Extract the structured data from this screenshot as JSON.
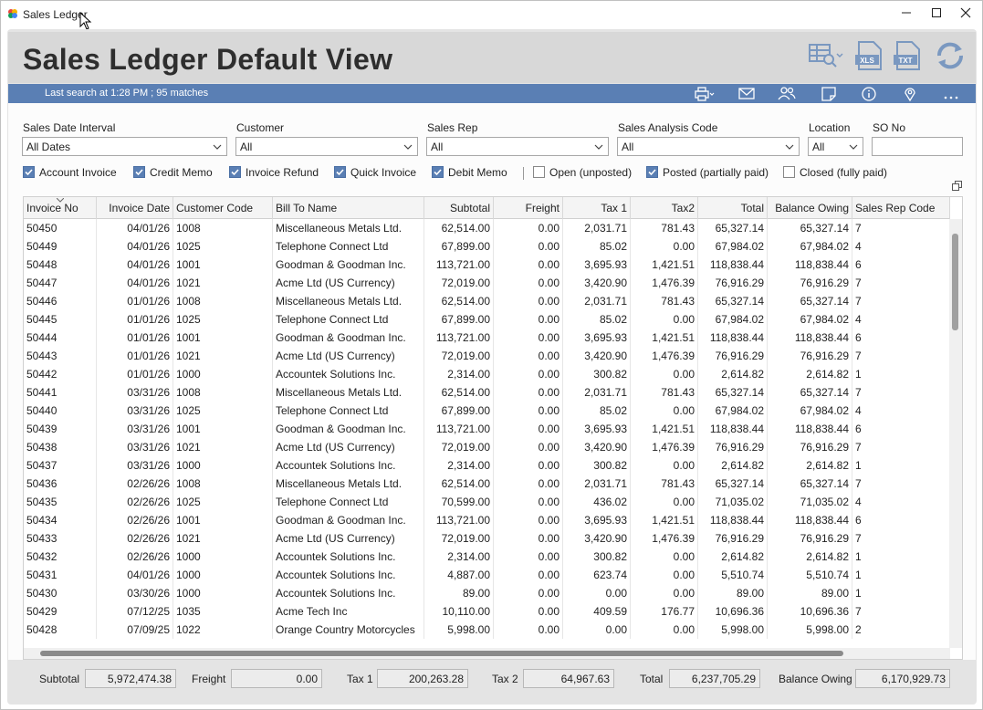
{
  "window": {
    "title": "Sales Ledger"
  },
  "header": {
    "title": "Sales Ledger Default View"
  },
  "statusbar": {
    "text": "Last search at 1:28 PM ; 95 matches"
  },
  "filters": {
    "date_label": "Sales Date Interval",
    "date_value": "All Dates",
    "customer_label": "Customer",
    "customer_value": "All",
    "rep_label": "Sales Rep",
    "rep_value": "All",
    "analysis_label": "Sales Analysis Code",
    "analysis_value": "All",
    "location_label": "Location",
    "location_value": "All",
    "so_label": "SO No",
    "so_value": ""
  },
  "checkboxes": [
    {
      "label": "Account Invoice",
      "checked": true
    },
    {
      "label": "Credit Memo",
      "checked": true
    },
    {
      "label": "Invoice Refund",
      "checked": true
    },
    {
      "label": "Quick Invoice",
      "checked": true
    },
    {
      "label": "Debit Memo",
      "checked": true
    },
    {
      "label": "Open (unposted)",
      "checked": false
    },
    {
      "label": "Posted (partially paid)",
      "checked": true
    },
    {
      "label": "Closed (fully paid)",
      "checked": false
    }
  ],
  "grid": {
    "columns": [
      "Invoice No",
      "Invoice Date",
      "Customer Code",
      "Bill To Name",
      "Subtotal",
      "Freight",
      "Tax 1",
      "Tax2",
      "Total",
      "Balance Owing",
      "Sales Rep Code"
    ],
    "rows": [
      [
        "50450",
        "04/01/26",
        "1008",
        "Miscellaneous Metals Ltd.",
        "62,514.00",
        "0.00",
        "2,031.71",
        "781.43",
        "65,327.14",
        "65,327.14",
        "7"
      ],
      [
        "50449",
        "04/01/26",
        "1025",
        "Telephone Connect Ltd",
        "67,899.00",
        "0.00",
        "85.02",
        "0.00",
        "67,984.02",
        "67,984.02",
        "4"
      ],
      [
        "50448",
        "04/01/26",
        "1001",
        "Goodman & Goodman Inc.",
        "113,721.00",
        "0.00",
        "3,695.93",
        "1,421.51",
        "118,838.44",
        "118,838.44",
        "6"
      ],
      [
        "50447",
        "04/01/26",
        "1021",
        "Acme Ltd (US Currency)",
        "72,019.00",
        "0.00",
        "3,420.90",
        "1,476.39",
        "76,916.29",
        "76,916.29",
        "7"
      ],
      [
        "50446",
        "01/01/26",
        "1008",
        "Miscellaneous Metals Ltd.",
        "62,514.00",
        "0.00",
        "2,031.71",
        "781.43",
        "65,327.14",
        "65,327.14",
        "7"
      ],
      [
        "50445",
        "01/01/26",
        "1025",
        "Telephone Connect Ltd",
        "67,899.00",
        "0.00",
        "85.02",
        "0.00",
        "67,984.02",
        "67,984.02",
        "4"
      ],
      [
        "50444",
        "01/01/26",
        "1001",
        "Goodman & Goodman Inc.",
        "113,721.00",
        "0.00",
        "3,695.93",
        "1,421.51",
        "118,838.44",
        "118,838.44",
        "6"
      ],
      [
        "50443",
        "01/01/26",
        "1021",
        "Acme Ltd (US Currency)",
        "72,019.00",
        "0.00",
        "3,420.90",
        "1,476.39",
        "76,916.29",
        "76,916.29",
        "7"
      ],
      [
        "50442",
        "01/01/26",
        "1000",
        "Accountek Solutions Inc.",
        "2,314.00",
        "0.00",
        "300.82",
        "0.00",
        "2,614.82",
        "2,614.82",
        "1"
      ],
      [
        "50441",
        "03/31/26",
        "1008",
        "Miscellaneous Metals Ltd.",
        "62,514.00",
        "0.00",
        "2,031.71",
        "781.43",
        "65,327.14",
        "65,327.14",
        "7"
      ],
      [
        "50440",
        "03/31/26",
        "1025",
        "Telephone Connect Ltd",
        "67,899.00",
        "0.00",
        "85.02",
        "0.00",
        "67,984.02",
        "67,984.02",
        "4"
      ],
      [
        "50439",
        "03/31/26",
        "1001",
        "Goodman & Goodman Inc.",
        "113,721.00",
        "0.00",
        "3,695.93",
        "1,421.51",
        "118,838.44",
        "118,838.44",
        "6"
      ],
      [
        "50438",
        "03/31/26",
        "1021",
        "Acme Ltd (US Currency)",
        "72,019.00",
        "0.00",
        "3,420.90",
        "1,476.39",
        "76,916.29",
        "76,916.29",
        "7"
      ],
      [
        "50437",
        "03/31/26",
        "1000",
        "Accountek Solutions Inc.",
        "2,314.00",
        "0.00",
        "300.82",
        "0.00",
        "2,614.82",
        "2,614.82",
        "1"
      ],
      [
        "50436",
        "02/26/26",
        "1008",
        "Miscellaneous Metals Ltd.",
        "62,514.00",
        "0.00",
        "2,031.71",
        "781.43",
        "65,327.14",
        "65,327.14",
        "7"
      ],
      [
        "50435",
        "02/26/26",
        "1025",
        "Telephone Connect Ltd",
        "70,599.00",
        "0.00",
        "436.02",
        "0.00",
        "71,035.02",
        "71,035.02",
        "4"
      ],
      [
        "50434",
        "02/26/26",
        "1001",
        "Goodman & Goodman Inc.",
        "113,721.00",
        "0.00",
        "3,695.93",
        "1,421.51",
        "118,838.44",
        "118,838.44",
        "6"
      ],
      [
        "50433",
        "02/26/26",
        "1021",
        "Acme Ltd (US Currency)",
        "72,019.00",
        "0.00",
        "3,420.90",
        "1,476.39",
        "76,916.29",
        "76,916.29",
        "7"
      ],
      [
        "50432",
        "02/26/26",
        "1000",
        "Accountek Solutions Inc.",
        "2,314.00",
        "0.00",
        "300.82",
        "0.00",
        "2,614.82",
        "2,614.82",
        "1"
      ],
      [
        "50431",
        "04/01/26",
        "1000",
        "Accountek Solutions Inc.",
        "4,887.00",
        "0.00",
        "623.74",
        "0.00",
        "5,510.74",
        "5,510.74",
        "1"
      ],
      [
        "50430",
        "03/30/26",
        "1000",
        "Accountek Solutions Inc.",
        "89.00",
        "0.00",
        "0.00",
        "0.00",
        "89.00",
        "89.00",
        "1"
      ],
      [
        "50429",
        "07/12/25",
        "1035",
        "Acme Tech Inc",
        "10,110.00",
        "0.00",
        "409.59",
        "176.77",
        "10,696.36",
        "10,696.36",
        "7"
      ],
      [
        "50428",
        "07/09/25",
        "1022",
        "Orange Country Motorcycles",
        "5,998.00",
        "0.00",
        "0.00",
        "0.00",
        "5,998.00",
        "5,998.00",
        "2"
      ]
    ]
  },
  "totals": {
    "subtotal_label": "Subtotal",
    "subtotal": "5,972,474.38",
    "freight_label": "Freight",
    "freight": "0.00",
    "tax1_label": "Tax 1",
    "tax1": "200,263.28",
    "tax2_label": "Tax 2",
    "tax2": "64,967.63",
    "total_label": "Total",
    "total": "6,237,705.29",
    "balance_label": "Balance Owing",
    "balance": "6,170,929.73"
  },
  "colors": {
    "accent": "#5a7fb4",
    "header_bg": "#d8d8d8",
    "checkbox_on": "#5a7fb4"
  }
}
